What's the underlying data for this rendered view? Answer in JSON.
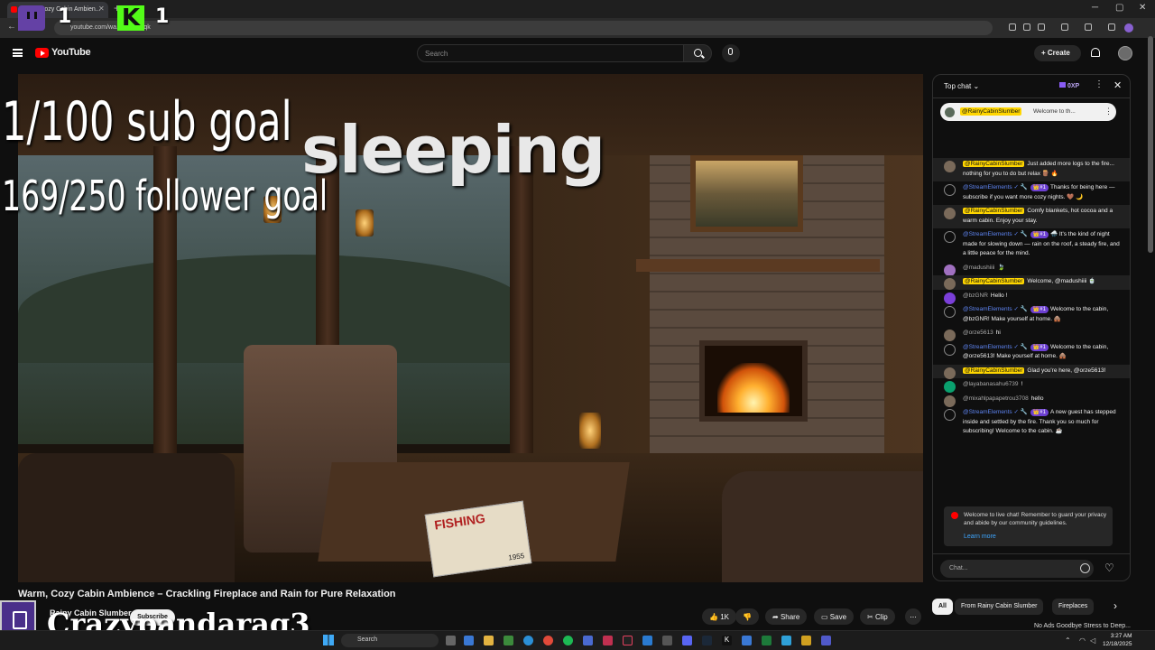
{
  "browser": {
    "tab_title": "Warm, Cozy Cabin Ambien...",
    "url": "youtube.com/wa... 3AFREqk"
  },
  "overlay": {
    "twitch_count": "1",
    "kick_count": "1",
    "sub_goal": "1/100 sub goal",
    "follower_goal": "169/250 follower goal",
    "status": "sleeping",
    "streamer_name": "Crazypandarag3"
  },
  "youtube": {
    "logo": "YouTube",
    "search_placeholder": "Search",
    "create_label": "Create"
  },
  "video": {
    "title": "Warm, Cozy Cabin Ambience – Crackling Fireplace and Rain for Pure Relaxation",
    "channel": "Rainy Cabin Slumber",
    "subscribe_label": "Subscribe",
    "magazine_title": "FISHING",
    "magazine_year": "1955",
    "actions": {
      "likes": "1K",
      "share": "Share",
      "save": "Save",
      "clip": "Clip",
      "more": "..."
    }
  },
  "chat": {
    "header": "Top chat",
    "xp": "0XP",
    "pinned": {
      "author": "@RainyCabinSlumber",
      "text": "Welcome to th..."
    },
    "messages": [
      {
        "author": "@RainyCabinSlumber",
        "type": "owner",
        "badge": "",
        "text": "Just added more logs to the fire... nothing for you to do but relax 🪵 🔥",
        "avatar": "o",
        "hl": true
      },
      {
        "author": "@StreamElements ✓ 🔧",
        "type": "mod",
        "badge": "👑#1",
        "text": "Thanks for being here — subscribe if you want more cozy nights. 🤎 🌙",
        "avatar": "se",
        "hl": false
      },
      {
        "author": "@RainyCabinSlumber",
        "type": "owner",
        "badge": "",
        "text": "Comfy blankets, hot cocoa and a warm cabin. Enjoy your stay.",
        "avatar": "o",
        "hl": true
      },
      {
        "author": "@StreamElements ✓ 🔧",
        "type": "mod",
        "badge": "👑#1",
        "text": "🌧️ It's the kind of night made for slowing down — rain on the roof, a steady fire, and a little peace for the mind.",
        "avatar": "se",
        "hl": false
      },
      {
        "author": "@madushiiii",
        "type": "",
        "badge": "",
        "text": "🍃",
        "avatar": "p",
        "hl": false
      },
      {
        "author": "@RainyCabinSlumber",
        "type": "owner",
        "badge": "",
        "text": "Welcome, @madushiiii 🍵",
        "avatar": "o",
        "hl": true
      },
      {
        "author": "@bzGNR",
        "type": "",
        "badge": "",
        "text": "Hello !",
        "avatar": "b",
        "hl": false
      },
      {
        "author": "@StreamElements ✓ 🔧",
        "type": "mod",
        "badge": "👑#1",
        "text": "Welcome to the cabin, @bzGNR! Make yourself at home. 🛖",
        "avatar": "se",
        "hl": false
      },
      {
        "author": "@orze5613",
        "type": "",
        "badge": "",
        "text": "hi",
        "avatar": "o",
        "hl": false
      },
      {
        "author": "@StreamElements ✓ 🔧",
        "type": "mod",
        "badge": "👑#1",
        "text": "Welcome to the cabin, @orze5613! Make yourself at home. 🛖",
        "avatar": "se",
        "hl": false
      },
      {
        "author": "@RainyCabinSlumber",
        "type": "owner",
        "badge": "",
        "text": "Glad you're here, @orze5613!",
        "avatar": "o",
        "hl": true
      },
      {
        "author": "@layabanasahu6739",
        "type": "",
        "badge": "",
        "text": "!",
        "avatar": "g",
        "hl": false
      },
      {
        "author": "@mixahlpapapetrou3708",
        "type": "",
        "badge": "",
        "text": "hello",
        "avatar": "o",
        "hl": false
      },
      {
        "author": "@StreamElements ✓ 🔧",
        "type": "mod",
        "badge": "👑#1",
        "text": "A new guest has stepped inside and settled by the fire. Thank you so much for subscribing! Welcome to the cabin. ☕",
        "avatar": "se",
        "hl": false
      }
    ],
    "system_message": "Welcome to live chat! Remember to guard your privacy and abide by our community guidelines.",
    "learn_more": "Learn more",
    "input_placeholder": "Chat..."
  },
  "chips": [
    "All",
    "From Rainy Cabin Slumber",
    "Fireplaces"
  ],
  "related_peek": "No Ads Goodbye Stress to Deep...",
  "taskbar": {
    "search": "Search",
    "time": "3:27 AM",
    "date": "12/18/2025"
  },
  "colors": {
    "youtube_red": "#ff0000",
    "owner_badge": "#ffd600",
    "twitch": "#6441a5",
    "kick": "#53fc18",
    "link": "#3ea6ff"
  }
}
